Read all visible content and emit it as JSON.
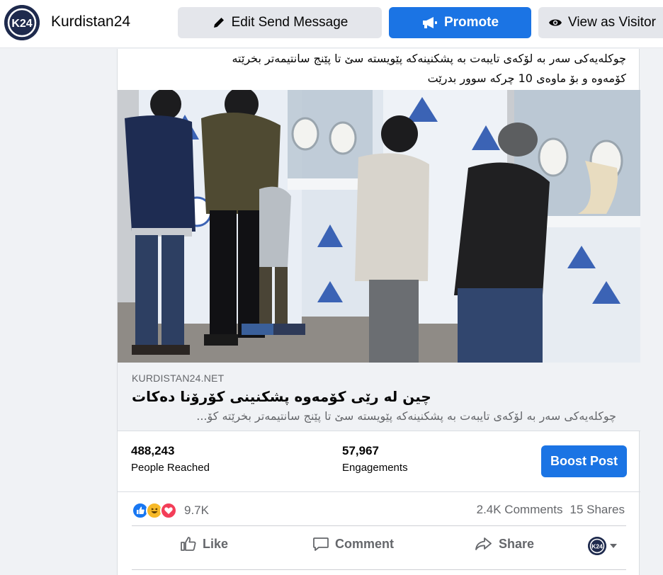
{
  "page": {
    "name": "Kurdistan24",
    "logo_text": "K24",
    "buttons": {
      "edit_send_message": "Edit Send Message",
      "promote": "Promote",
      "view_as_visitor": "View as Visitor"
    }
  },
  "post": {
    "caption_lines": [
      "چوکلەیەکی سەر بە لۆکەی تایبەت بە پشکنینەکە پێویستە سێ تا پێنج سانتیمەتر بخرێتە",
      "کۆمەوە و بۆ ماوەی 10 چرکە سوور بدرێت"
    ],
    "link": {
      "domain": "KURDISTAN24.NET",
      "title": "چین لە رێی کۆمەوە پشکنینی کۆرۆنا دەکات",
      "description": "چوکلەیەکی سەر بە لۆکەی تایبەت بە پشکنینەکە پێویستە سێ تا پێنج سانتیمەتر بخرێتە کۆ..."
    },
    "insights": {
      "people_reached_value": "488,243",
      "people_reached_label": "People Reached",
      "engagements_value": "57,967",
      "engagements_label": "Engagements",
      "boost_label": "Boost Post"
    },
    "reactions": {
      "icons": [
        "like-reaction",
        "haha-reaction",
        "love-reaction"
      ],
      "count": "9.7K",
      "comments": "2.4K Comments",
      "shares": "15 Shares"
    },
    "actions": {
      "like": "Like",
      "comment": "Comment",
      "share": "Share"
    }
  },
  "colors": {
    "primary_blue": "#1b74e4",
    "background": "#f0f2f5",
    "secondary_text": "#65676b",
    "logo_navy": "#1e2a4d"
  }
}
